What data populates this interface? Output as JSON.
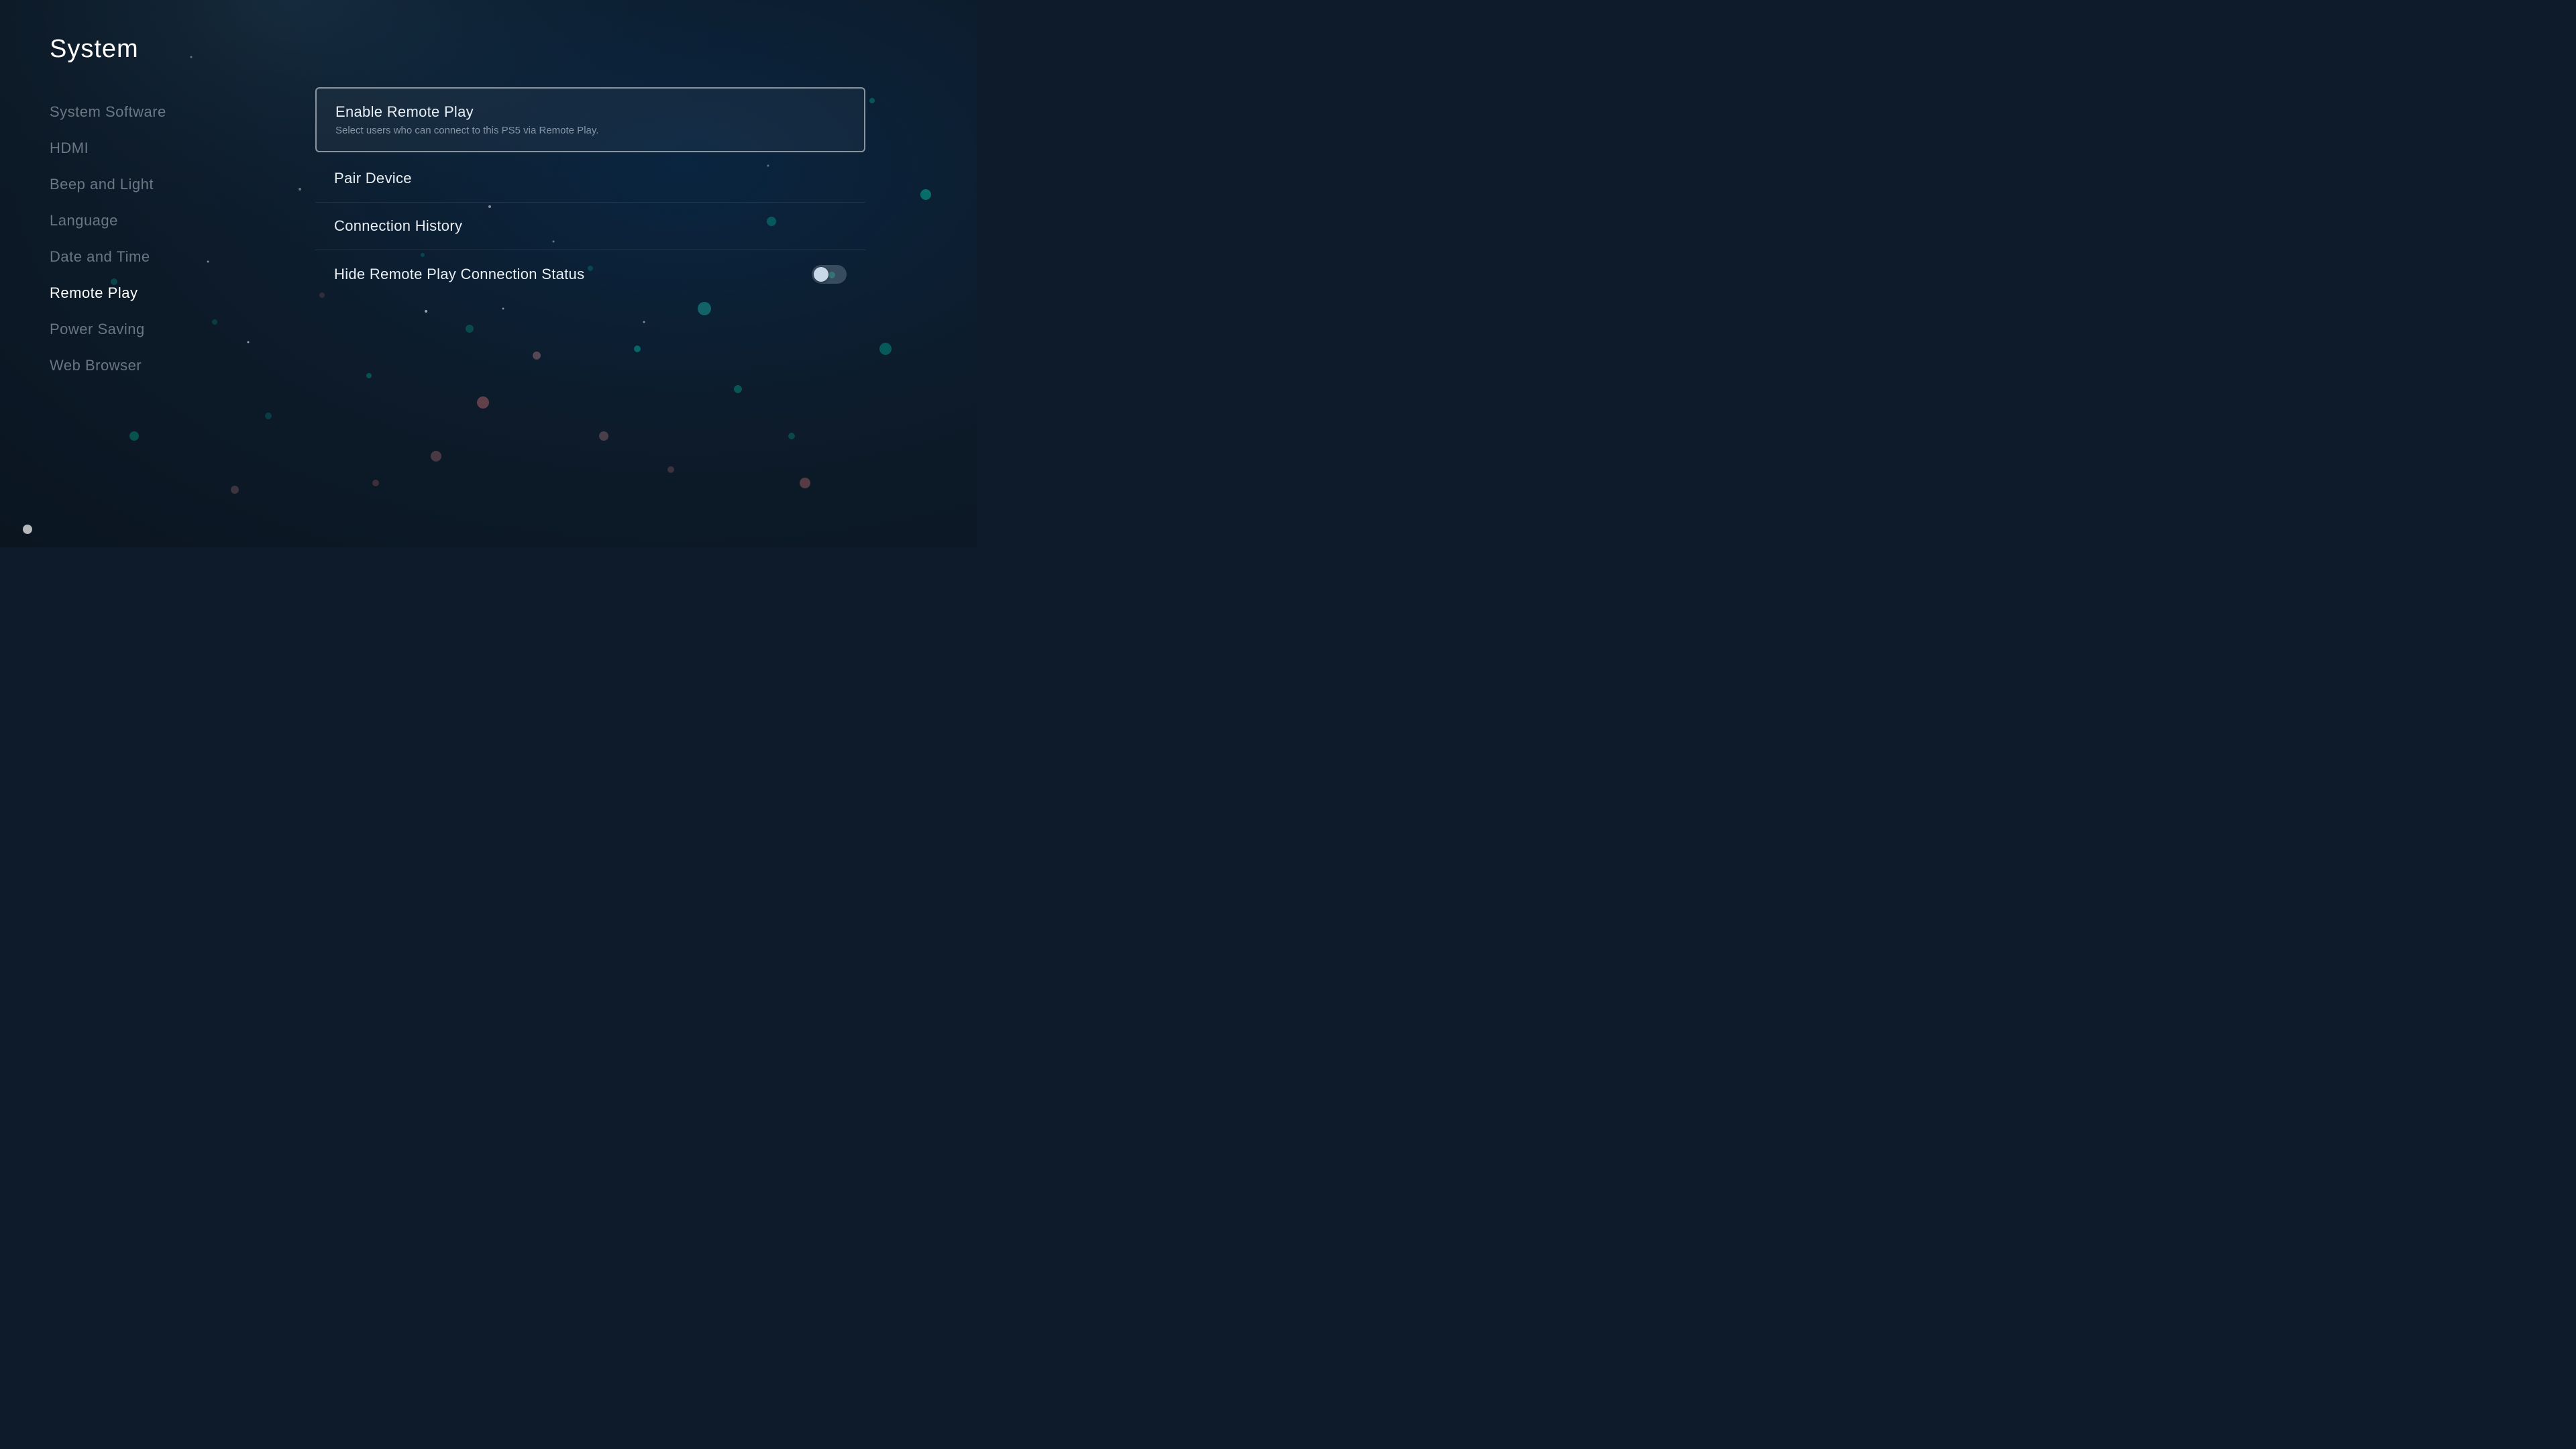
{
  "page": {
    "title": "System"
  },
  "sidebar": {
    "items": [
      {
        "id": "system-software",
        "label": "System Software",
        "active": false
      },
      {
        "id": "hdmi",
        "label": "HDMI",
        "active": false
      },
      {
        "id": "beep-and-light",
        "label": "Beep and Light",
        "active": false
      },
      {
        "id": "language",
        "label": "Language",
        "active": false
      },
      {
        "id": "date-and-time",
        "label": "Date and Time",
        "active": false
      },
      {
        "id": "remote-play",
        "label": "Remote Play",
        "active": true
      },
      {
        "id": "power-saving",
        "label": "Power Saving",
        "active": false
      },
      {
        "id": "web-browser",
        "label": "Web Browser",
        "active": false
      }
    ]
  },
  "content": {
    "items": [
      {
        "id": "enable-remote-play",
        "title": "Enable Remote Play",
        "subtitle": "Select users who can connect to this PS5 via Remote Play.",
        "has_toggle": false,
        "is_highlighted": true
      },
      {
        "id": "pair-device",
        "title": "Pair Device",
        "subtitle": "",
        "has_toggle": false,
        "is_highlighted": false
      },
      {
        "id": "connection-history",
        "title": "Connection History",
        "subtitle": "",
        "has_toggle": false,
        "is_highlighted": false
      },
      {
        "id": "hide-remote-play-connection-status",
        "title": "Hide Remote Play Connection Status",
        "subtitle": "",
        "has_toggle": true,
        "toggle_on": false,
        "is_highlighted": false
      }
    ]
  }
}
